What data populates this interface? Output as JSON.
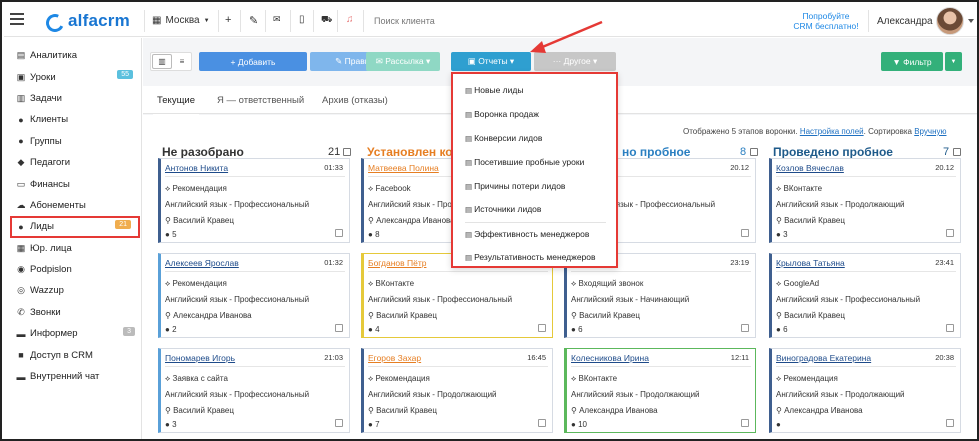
{
  "topbar": {
    "logo_text": "alfacrm",
    "city": "Москва",
    "search_placeholder": "Поиск клиента",
    "promo_line1": "Попробуйте",
    "promo_line2": "CRM бесплатно!",
    "user_name": "Александра",
    "colors": {
      "brand": "#1976d2",
      "bell": "#e57373"
    }
  },
  "sidebar": {
    "items": [
      {
        "label": "Аналитика",
        "icon": "book-icon"
      },
      {
        "label": "Уроки",
        "icon": "calendar-icon",
        "badge": "55",
        "badge_color": "#5bc0de"
      },
      {
        "label": "Задачи",
        "icon": "clipboard-icon"
      },
      {
        "label": "Клиенты",
        "icon": "user-icon"
      },
      {
        "label": "Группы",
        "icon": "users-icon"
      },
      {
        "label": "Педагоги",
        "icon": "graduation-cap-icon"
      },
      {
        "label": "Финансы",
        "icon": "money-icon"
      },
      {
        "label": "Абонементы",
        "icon": "cloud-icon"
      },
      {
        "label": "Лиды",
        "icon": "user-plus-icon",
        "badge": "21",
        "badge_color": "#f0ad4e"
      },
      {
        "label": "Юр. лица",
        "icon": "building-icon"
      },
      {
        "label": "Podpislon",
        "icon": "bell-icon"
      },
      {
        "label": "Wazzup",
        "icon": "whatsapp-icon"
      },
      {
        "label": "Звонки",
        "icon": "phone-icon"
      },
      {
        "label": "Информер",
        "icon": "comment-icon",
        "badge": "3",
        "badge_color": "#bbbbbb"
      },
      {
        "label": "Доступ в CRM",
        "icon": "lock-icon"
      },
      {
        "label": "Внутренний чат",
        "icon": "chat-icon"
      }
    ]
  },
  "toolbar": {
    "add": "+ Добавить",
    "edit": "✎ Править",
    "mail": "✉ Рассылка ▾",
    "reports": "▣ Отчеты ▾",
    "other": "··· Другое ▾",
    "filter": "▼ Фильтр"
  },
  "tabs": [
    "Текущие",
    "Я — ответственный",
    "Архив (отказы)"
  ],
  "board": {
    "info_prefix": "Отображено 5 этапов воронки.",
    "info_link1": "Настройка полей",
    "info_mid": ". Сортировка",
    "info_link2": "Вручную",
    "columns": [
      {
        "title": "Не разобрано",
        "count": "21",
        "color": "#333333"
      },
      {
        "title": "Установлен кон",
        "count": "",
        "color": "#e67e22"
      },
      {
        "title": "но пробное",
        "count": "8",
        "color": "#2a7fc1"
      },
      {
        "title": "Проведено пробное",
        "count": "7",
        "color": "#1e5a8a"
      }
    ]
  },
  "cards": [
    [
      {
        "name": "Антонов Никита",
        "time": "01:33",
        "source": "Рекомендация",
        "course": "Английский язык - Профессиональный",
        "teacher": "Василий Кравец",
        "comments": "5",
        "border": "#3f5f8f"
      },
      {
        "name": "Алексеев Ярослав",
        "time": "01:32",
        "source": "Рекомендация",
        "course": "Английский язык - Профессиональный",
        "teacher": "Александра Иванова",
        "comments": "2",
        "border": "#5aa0d8"
      },
      {
        "name": "Пономарев Игорь",
        "time": "21:03",
        "source": "Заявка с сайта",
        "course": "Английский язык - Профессиональный",
        "teacher": "Василий Кравец",
        "comments": "3",
        "border": "#5aa0d8"
      }
    ],
    [
      {
        "name": "Матвеева Полина",
        "time": "",
        "source": "Facebook",
        "course": "Английский язык - Профессиональный",
        "teacher": "Александра Иванова",
        "comments": "8",
        "border": "#3f5f8f"
      },
      {
        "name": "Богданов Пётр",
        "time": "",
        "source": "ВКонтакте",
        "course": "Английский язык - Профессиональный",
        "teacher": "Василий Кравец",
        "comments": "4",
        "border": "#e5c93a"
      },
      {
        "name": "Егоров Захар",
        "time": "16:45",
        "source": "Рекомендация",
        "course": "Английский язык - Продолжающий",
        "teacher": "Василий Кравец",
        "comments": "7",
        "border": "#3f5f8f"
      }
    ],
    [
      {
        "name": "Анастасия",
        "time": "20.12",
        "source": "сайта",
        "course": "Английский язык - Профессиональный",
        "teacher": "Кравец",
        "comments": "",
        "border": "#3f5f8f"
      },
      {
        "name": "на",
        "time": "23:19",
        "source": "Входящий звонок",
        "course": "Английский язык - Начинающий",
        "teacher": "Василий Кравец",
        "comments": "6",
        "border": "#3f5f8f"
      },
      {
        "name": "Колесникова Ирина",
        "time": "12:11",
        "source": "ВКонтакте",
        "course": "Английский язык - Продолжающий",
        "teacher": "Александра Иванова",
        "comments": "10",
        "border": "#5cb85c"
      }
    ],
    [
      {
        "name": "Козлов Вячеслав",
        "time": "20.12",
        "source": "ВКонтакте",
        "course": "Английский язык - Продолжающий",
        "teacher": "Василий Кравец",
        "comments": "3",
        "border": "#3f5f8f"
      },
      {
        "name": "Крылова Татьяна",
        "time": "23:41",
        "source": "GoogleAd",
        "course": "Английский язык - Профессиональный",
        "teacher": "Василий Кравец",
        "comments": "6",
        "border": "#3f5f8f"
      },
      {
        "name": "Виноградова Екатерина",
        "time": "20:38",
        "source": "Рекомендация",
        "course": "Английский язык - Продолжающий",
        "teacher": "Александра Иванова",
        "comments": "",
        "border": "#3f5f8f"
      }
    ]
  ],
  "reports_menu": {
    "items": [
      "Новые лиды",
      "Воронка продаж",
      "Конверсии лидов",
      "Посетившие пробные уроки",
      "Причины потери лидов",
      "Источники лидов"
    ],
    "items2": [
      "Эффективность менеджеров",
      "Результативность менеджеров"
    ]
  }
}
